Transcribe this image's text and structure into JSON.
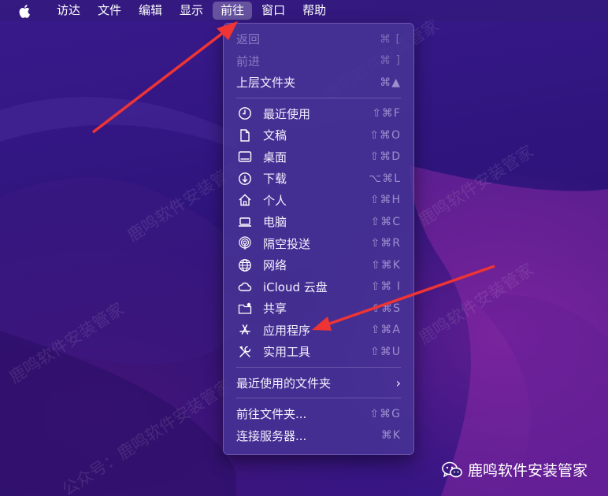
{
  "menubar": {
    "items": [
      "访达",
      "文件",
      "编辑",
      "显示",
      "前往",
      "窗口",
      "帮助"
    ],
    "active_index": 4
  },
  "go_menu": {
    "group1": [
      {
        "label": "返回",
        "shortcut": "⌘ [",
        "disabled": true
      },
      {
        "label": "前进",
        "shortcut": "⌘ ]",
        "disabled": true
      },
      {
        "label": "上层文件夹",
        "shortcut": "⌘▲",
        "disabled": false
      }
    ],
    "group2": [
      {
        "label": "最近使用",
        "shortcut": "⇧⌘F",
        "icon": "clock-icon"
      },
      {
        "label": "文稿",
        "shortcut": "⇧⌘O",
        "icon": "document-icon"
      },
      {
        "label": "桌面",
        "shortcut": "⇧⌘D",
        "icon": "desktop-icon"
      },
      {
        "label": "下载",
        "shortcut": "⌥⌘L",
        "icon": "download-icon"
      },
      {
        "label": "个人",
        "shortcut": "⇧⌘H",
        "icon": "home-icon"
      },
      {
        "label": "电脑",
        "shortcut": "⇧⌘C",
        "icon": "computer-icon"
      },
      {
        "label": "隔空投送",
        "shortcut": "⇧⌘R",
        "icon": "airdrop-icon"
      },
      {
        "label": "网络",
        "shortcut": "⇧⌘K",
        "icon": "network-icon"
      },
      {
        "label": "iCloud 云盘",
        "shortcut": "⇧⌘ I",
        "icon": "cloud-icon"
      },
      {
        "label": "共享",
        "shortcut": "⇧⌘S",
        "icon": "shared-folder-icon"
      },
      {
        "label": "应用程序",
        "shortcut": "⇧⌘A",
        "icon": "applications-icon"
      },
      {
        "label": "实用工具",
        "shortcut": "⇧⌘U",
        "icon": "utilities-icon"
      }
    ],
    "recent_folders": {
      "label": "最近使用的文件夹",
      "arrow": "›"
    },
    "group4": [
      {
        "label": "前往文件夹...",
        "shortcut": "⇧⌘G"
      },
      {
        "label": "连接服务器...",
        "shortcut": "⌘K"
      }
    ]
  },
  "watermark": {
    "text": "鹿鸣软件安装管家",
    "prefix": "公众号："
  },
  "brand": {
    "text": "鹿鸣软件安装管家"
  },
  "colors": {
    "menu_bg": "#4834a0",
    "arrow": "#ee3434",
    "accent_wallpaper": "#8c28aa"
  }
}
